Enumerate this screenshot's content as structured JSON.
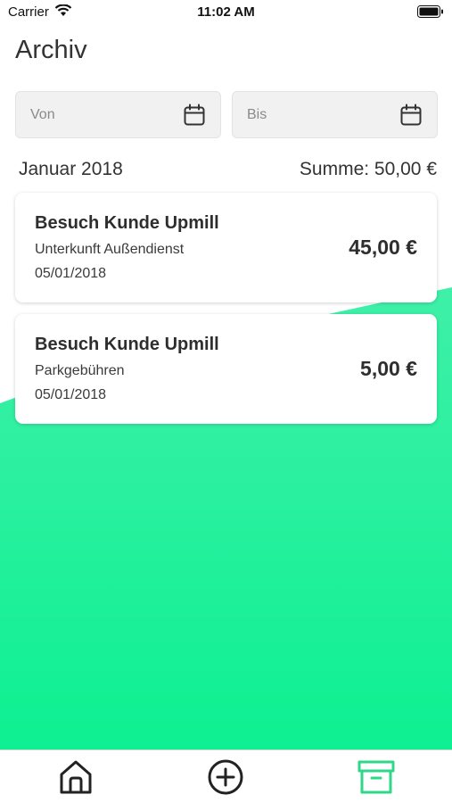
{
  "status_bar": {
    "carrier": "Carrier",
    "time": "11:02 AM",
    "icons": [
      "wifi-icon",
      "battery-icon"
    ]
  },
  "page": {
    "title": "Archiv"
  },
  "filters": {
    "from_placeholder": "Von",
    "to_placeholder": "Bis",
    "icon": "calendar-icon"
  },
  "summary": {
    "month": "Januar 2018",
    "total": "Summe: 50,00 €"
  },
  "entries": [
    {
      "title": "Besuch Kunde Upmill",
      "category": "Unterkunft Außendienst",
      "date": "05/01/2018",
      "amount": "45,00 €"
    },
    {
      "title": "Besuch Kunde Upmill",
      "category": "Parkgebühren",
      "date": "05/01/2018",
      "amount": "5,00 €"
    }
  ],
  "tab_bar": {
    "tabs": [
      {
        "icon": "home-icon",
        "active": false
      },
      {
        "icon": "plus-circle-icon",
        "active": false
      },
      {
        "icon": "archive-box-icon",
        "active": true
      }
    ]
  },
  "colors": {
    "accent": "#2ed888",
    "gradient_top": "#3ff0a8",
    "gradient_bottom": "#0df092",
    "inactive_icon": "#222222"
  }
}
